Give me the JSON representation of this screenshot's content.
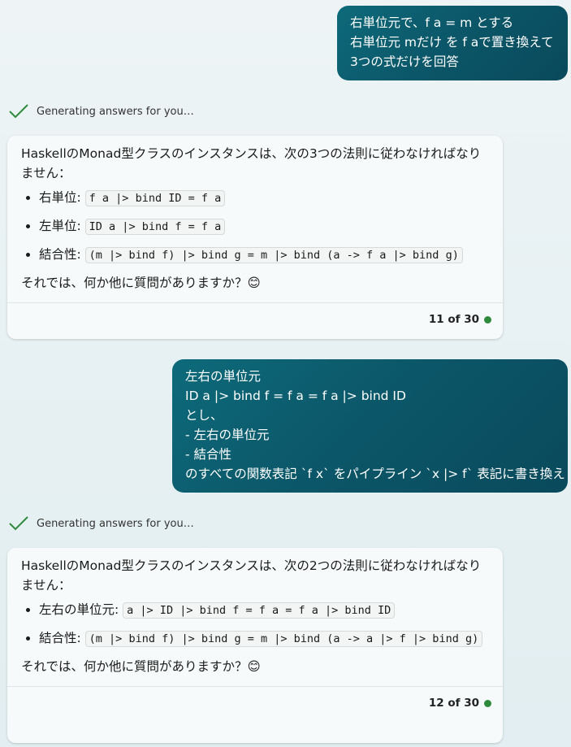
{
  "conversation": {
    "user_message_1": {
      "lines": [
        "右単位元で、f a = m とする",
        "右単位元 mだけ を f aで置き換えて",
        "3つの式だけを回答"
      ]
    },
    "status_1": {
      "text": "Generating answers for you…"
    },
    "bot_message_1": {
      "intro": "HaskellのMonad型クラスのインスタンスは、次の3つの法則に従わなければなりません：",
      "laws": [
        {
          "label": "右単位:",
          "code": "f a |> bind ID = f a"
        },
        {
          "label": "左単位:",
          "code": "ID a |> bind f = f a"
        },
        {
          "label": "結合性:",
          "code": "(m |> bind f) |> bind g = m |> bind (a -> f a |> bind g)"
        }
      ],
      "closing": "それでは、何か他に質問がありますか？😊",
      "counter": "11 of 30"
    },
    "user_message_2": {
      "lines": [
        "左右の単位元",
        "ID a |> bind f = f a = f a |> bind ID",
        "とし、",
        "- 左右の単位元",
        "- 結合性",
        "のすべての関数表記 `f x` をパイプライン `x |> f` 表記に書き換え"
      ]
    },
    "status_2": {
      "text": "Generating answers for you…"
    },
    "bot_message_2": {
      "intro": "HaskellのMonad型クラスのインスタンスは、次の2つの法則に従わなければなりません：",
      "laws": [
        {
          "label": "左右の単位元:",
          "code": "a |> ID |> bind f = f a = f a |> bind ID"
        },
        {
          "label": "結合性:",
          "code": "(m |> bind f) |> bind g = m |> bind (a -> a |> f |> bind g)"
        }
      ],
      "closing": "それでは、何か他に質問がありますか？😊",
      "counter": "12 of 30"
    }
  },
  "colors": {
    "user_bubble": "#0b5668",
    "check_icon": "#2f8a3b",
    "status_dot": "#2f8a3b"
  }
}
